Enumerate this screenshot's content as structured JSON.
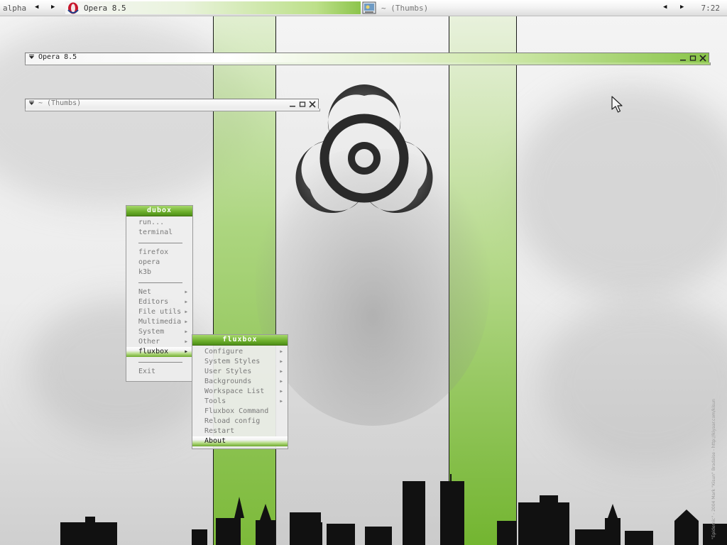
{
  "toolbar": {
    "workspace": "alpha",
    "tasks": [
      {
        "label": "Opera 8.5",
        "active": true
      },
      {
        "label": "~ (Thumbs)",
        "active": false
      }
    ],
    "clock": "7:22"
  },
  "windows": [
    {
      "title": "Opera 8.5",
      "focused": true
    },
    {
      "title": "~ (Thumbs)",
      "focused": false
    }
  ],
  "root_menu": {
    "title": "dubox",
    "items": [
      "run...",
      "terminal",
      "firefox",
      "opera",
      "k3b",
      "Net",
      "Editors",
      "File utils",
      "Multimedia",
      "System",
      "Other",
      "fluxbox",
      "Exit"
    ],
    "selected": "fluxbox"
  },
  "fluxbox_menu": {
    "title": "fluxbox",
    "items": [
      "Configure",
      "System Styles",
      "User Styles",
      "Backgrounds",
      "Workspace List",
      "Tools",
      "Fluxbox Command",
      "Reload config",
      "Restart",
      "About"
    ],
    "selected": "About"
  },
  "wallpaper": {
    "credit": "\"Epidemic\" - 2004 Mark \"Kisun\" Bradaise - http://kiyaar.com/kisun"
  },
  "colors": {
    "accent_green": "#7cbf3a",
    "menu_title_green": "#6caf2b",
    "text_dim": "#7a7a7a"
  }
}
